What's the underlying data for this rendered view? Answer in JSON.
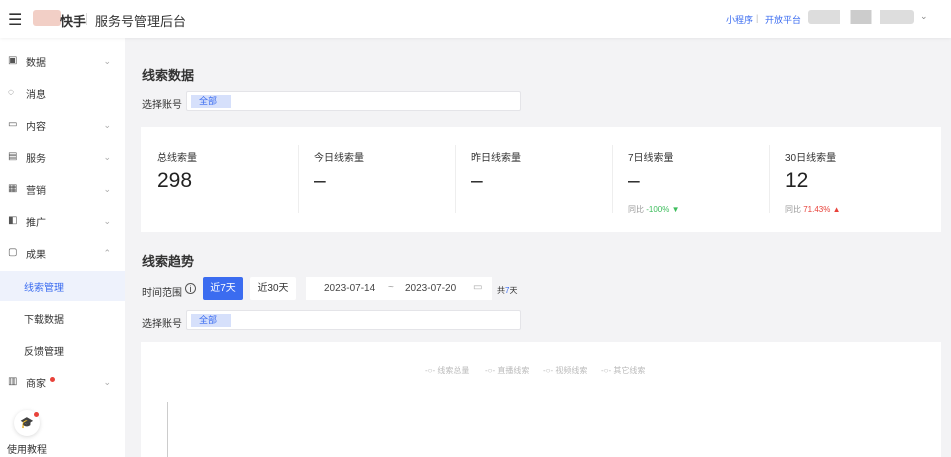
{
  "header": {
    "brand": "快手",
    "title": "服务号管理后台",
    "links": [
      "小程序",
      "开放平台"
    ],
    "separator": "|"
  },
  "sidebar": {
    "items": [
      {
        "label": "数据",
        "icon": "monitor-icon",
        "chev": "⌄"
      },
      {
        "label": "消息",
        "icon": "chat-icon"
      },
      {
        "label": "内容",
        "icon": "video-icon",
        "chev": "⌄"
      },
      {
        "label": "服务",
        "icon": "service-icon",
        "chev": "⌄"
      },
      {
        "label": "营销",
        "icon": "grid-icon",
        "chev": "⌄"
      },
      {
        "label": "推广",
        "icon": "promote-icon",
        "chev": "⌄"
      },
      {
        "label": "成果",
        "icon": "result-icon",
        "chev": "⌃"
      },
      {
        "label": "线索管理",
        "active": true
      },
      {
        "label": "下载数据"
      },
      {
        "label": "反馈管理"
      },
      {
        "label": "商家",
        "icon": "shop-icon",
        "chev": "⌄"
      }
    ],
    "tutorial": "使用教程"
  },
  "leads": {
    "title": "线索数据",
    "account_label": "选择账号",
    "account_tag": "全部",
    "stats": [
      {
        "title": "总线索量",
        "value": "298"
      },
      {
        "title": "今日线索量",
        "value": "–"
      },
      {
        "title": "昨日线索量",
        "value": "–"
      },
      {
        "title": "7日线索量",
        "value": "–",
        "cmp_label": "同比",
        "cmp": "-100%",
        "dir": "▼"
      },
      {
        "title": "30日线索量",
        "value": "12",
        "cmp_label": "同比",
        "cmp": "71.43%",
        "dir": "▲"
      }
    ]
  },
  "trend": {
    "title": "线索趋势",
    "range_label": "时间范围",
    "btn7": "近7天",
    "btn30": "近30天",
    "start": "2023-07-14",
    "tilde": "~",
    "end": "2023-07-20",
    "total_prefix": "共",
    "total_num": "7",
    "total_suffix": "天",
    "account_label": "选择账号",
    "account_tag": "全部",
    "legend": [
      "线索总量",
      "直播线索",
      "视频线索",
      "其它线索"
    ]
  },
  "colors": {
    "accent": "#3b6cf0",
    "up": "#e8423a",
    "down": "#3dbd5c"
  }
}
